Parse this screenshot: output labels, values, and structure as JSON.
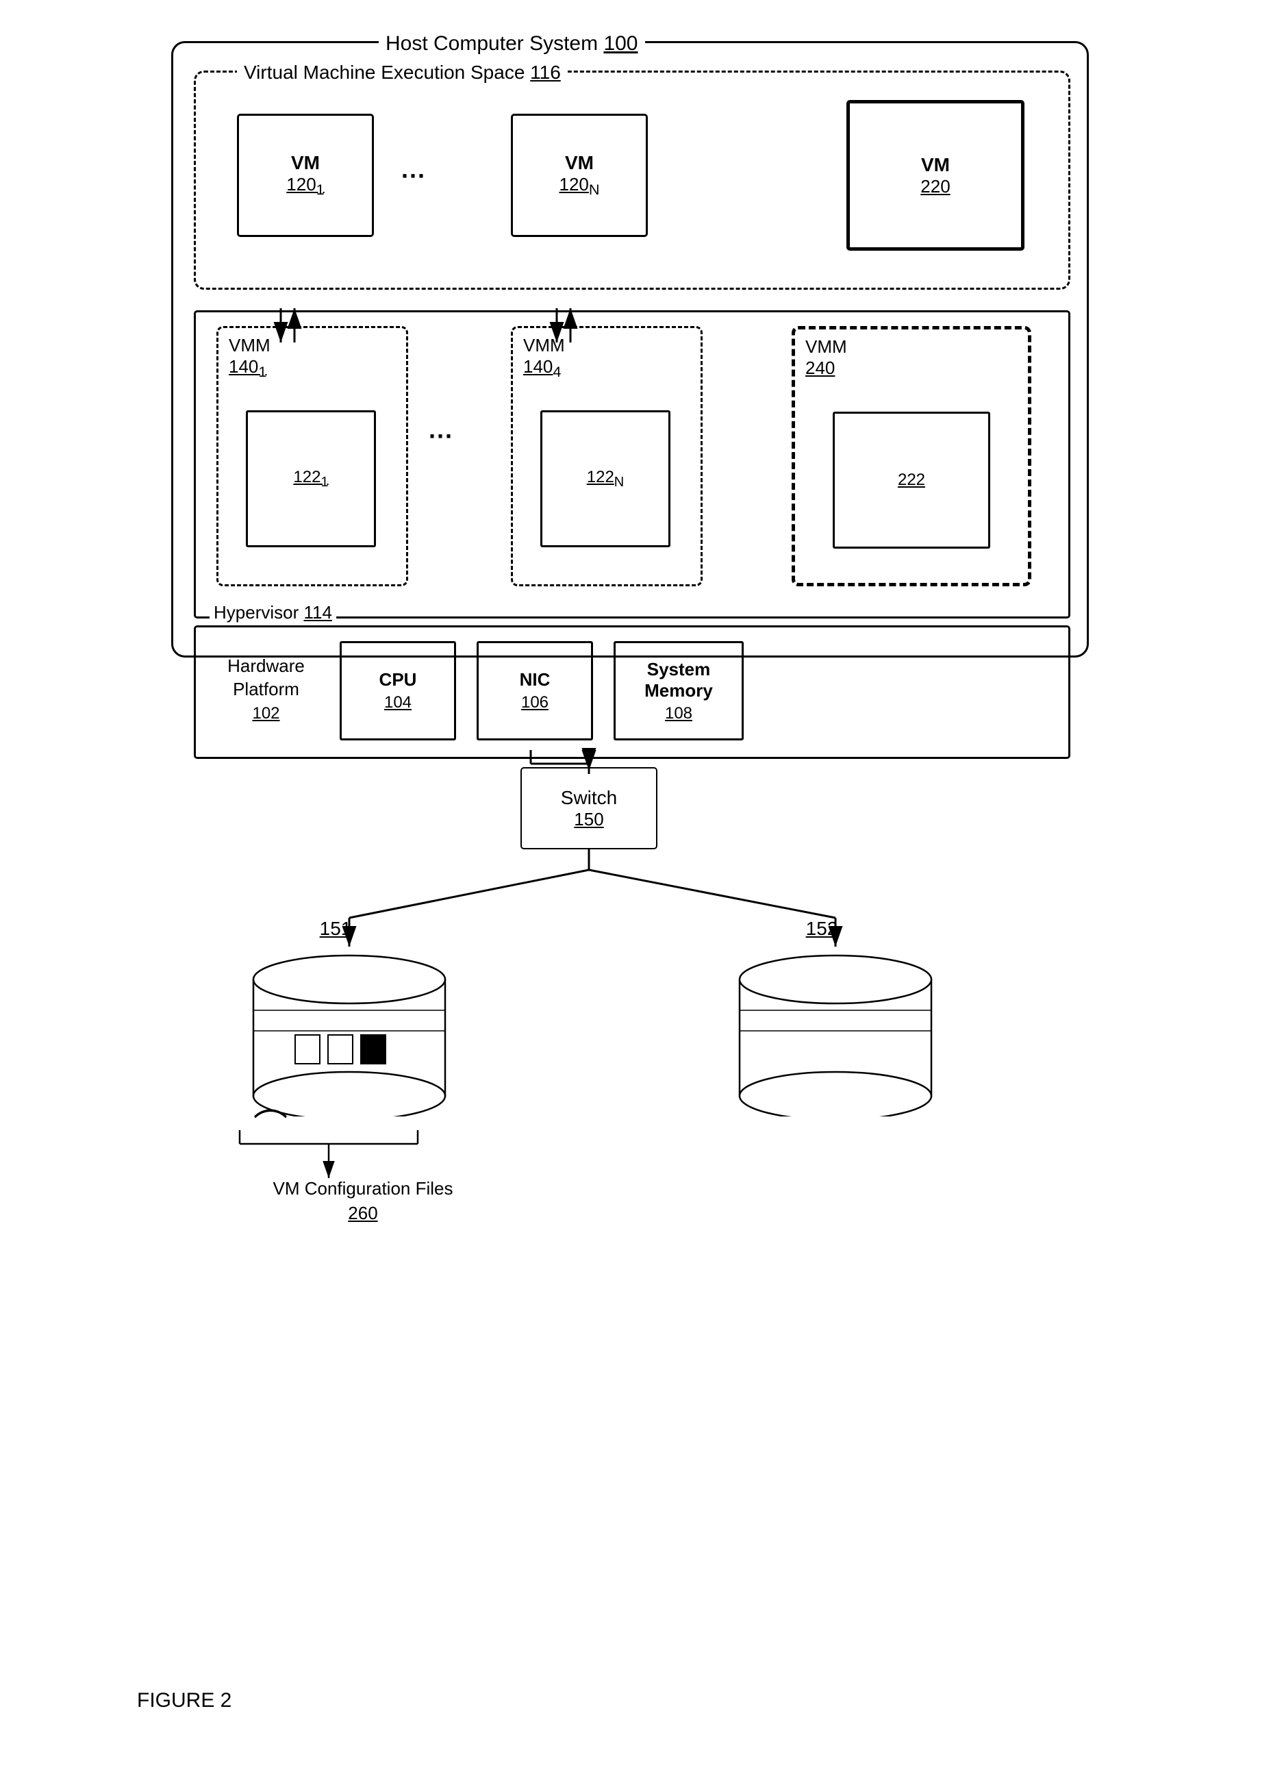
{
  "title": "FIGURE 2",
  "host": {
    "label": "Host Computer System",
    "number": "100"
  },
  "vmExecSpace": {
    "label": "Virtual Machine Execution Space",
    "number": "116"
  },
  "vms": [
    {
      "label": "VM",
      "number": "120",
      "subscript": "1"
    },
    {
      "label": "VM",
      "number": "120",
      "subscript": "N"
    },
    {
      "label": "VM",
      "number": "220",
      "subscript": ""
    }
  ],
  "vmms": [
    {
      "label": "VMM",
      "number": "140",
      "subscript": "1",
      "cpu": "122",
      "cpuSub": "1"
    },
    {
      "label": "VMM",
      "number": "140",
      "subscript": "4",
      "cpu": "122",
      "cpuSub": "N"
    },
    {
      "label": "VMM",
      "number": "240",
      "subscript": "",
      "cpu": "222",
      "cpuSub": ""
    }
  ],
  "hypervisor": {
    "label": "Hypervisor",
    "number": "114"
  },
  "hardware": {
    "label": "Hardware Platform",
    "number": "102",
    "items": [
      {
        "label": "CPU",
        "number": "104"
      },
      {
        "label": "NIC",
        "number": "106"
      },
      {
        "label": "System Memory",
        "number": "108"
      }
    ]
  },
  "switch": {
    "label": "Switch",
    "number": "150"
  },
  "storages": [
    {
      "number": "151"
    },
    {
      "number": "152"
    }
  ],
  "configFiles": {
    "label": "VM Configuration Files",
    "number": "260"
  },
  "dots": "..."
}
